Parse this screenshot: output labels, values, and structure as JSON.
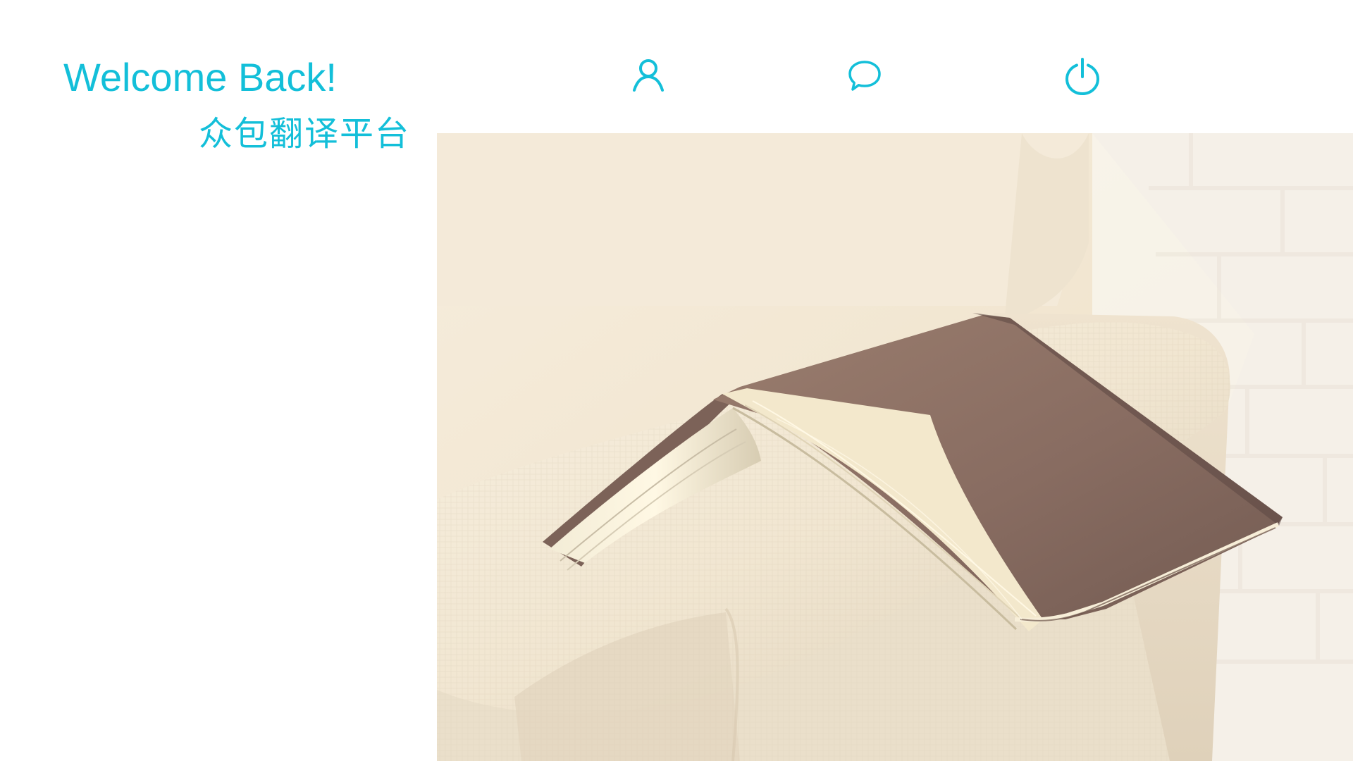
{
  "header": {
    "welcome_text": "Welcome Back!",
    "platform_name": "众包翻译平台",
    "accent_color": "#13bfd9"
  },
  "nav": {
    "icons": [
      {
        "name": "user-icon"
      },
      {
        "name": "chat-bubble-icon"
      },
      {
        "name": "power-icon"
      }
    ]
  },
  "hero": {
    "image_subject": "open book on cream sofa arm"
  }
}
